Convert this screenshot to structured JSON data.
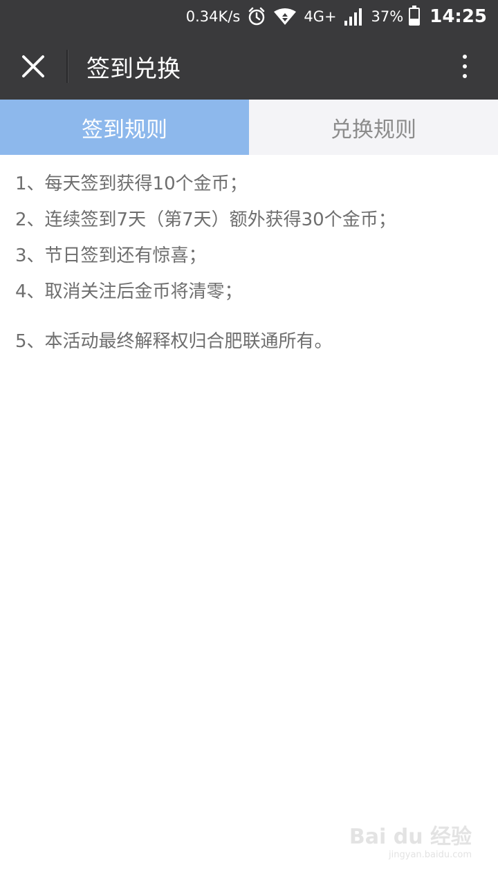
{
  "status_bar": {
    "network_speed": "0.34K/s",
    "network_type": "4G+",
    "battery_percent": "37%",
    "battery_level": 0.37,
    "time": "14:25",
    "icons": [
      "alarm-icon",
      "wifi-icon",
      "signal-icon",
      "battery-icon"
    ]
  },
  "header": {
    "title": "签到兑换",
    "close_icon": "close-icon",
    "more_icon": "more-vertical-icon"
  },
  "tabs": [
    {
      "label": "签到规则",
      "active": true
    },
    {
      "label": "兑换规则",
      "active": false
    }
  ],
  "rules": [
    "1、每天签到获得10个金币；",
    "2、连续签到7天（第7天）额外获得30个金币；",
    "3、节日签到还有惊喜；",
    "4、取消关注后金币将清零；",
    "5、本活动最终解释权归合肥联通所有。"
  ],
  "watermark": {
    "logo": "Bai du 经验",
    "url": "jingyan.baidu.com"
  },
  "colors": {
    "header_bg": "#3a3a3c",
    "tab_active_bg": "#8db8ec",
    "tab_inactive_bg": "#f4f4f7",
    "rule_text": "#6e6e6e"
  }
}
